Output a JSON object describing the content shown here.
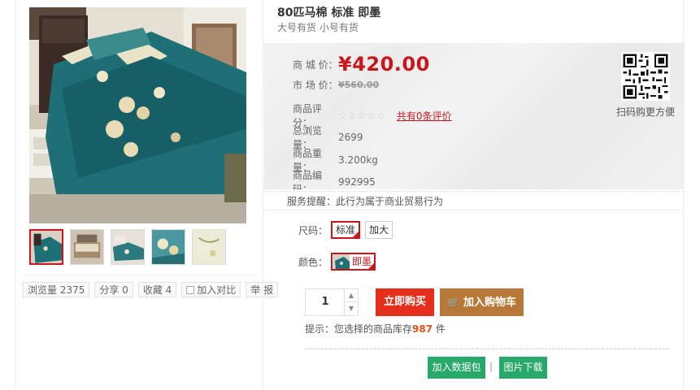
{
  "product": {
    "title": "80匹马棉 标准 即墨",
    "subtitle": "大号有货 小号有货"
  },
  "pricing": {
    "mall_price_label": "商 城 价：",
    "mall_price": "¥420.00",
    "market_price_label": "市 场 价：",
    "market_price": "¥560.00",
    "rating_label": "商品评分：",
    "rating_stars": 0,
    "rating_max": 5,
    "review_link": "共有0条评价",
    "views_label": "总浏览量：",
    "views": "2699",
    "weight_label": "商品重量：",
    "weight": "3.200kg",
    "code_label": "商品编码：",
    "code": "992995"
  },
  "qr": {
    "caption": "扫码购更方便"
  },
  "service": {
    "text": "服务提醒：此行为属于商业贸易行为"
  },
  "options": {
    "size_label": "尺码：",
    "sizes": [
      "标准",
      "加大"
    ],
    "color_label": "颜色：",
    "color_value": "即墨"
  },
  "purchase": {
    "quantity": "1",
    "buy_now": "立即购买",
    "add_to_cart": "加入购物车",
    "stock_tip_prefix": "提示：您选择的商品库存",
    "stock_count": "987",
    "stock_tip_suffix": "件"
  },
  "actions": {
    "add_package": "加入数据包",
    "separator": "|",
    "download_images": "图片下载"
  },
  "stats": {
    "views": "浏览量 2375",
    "share": "分享 0",
    "favorites": "收藏 4",
    "compare": "加入对比",
    "report": "举 报"
  },
  "colors": {
    "accent_red": "#c8161d",
    "buy_red": "#e52e1b",
    "cart_brown": "#b87838",
    "green": "#28a96a",
    "stock_orange": "#e5531b"
  }
}
